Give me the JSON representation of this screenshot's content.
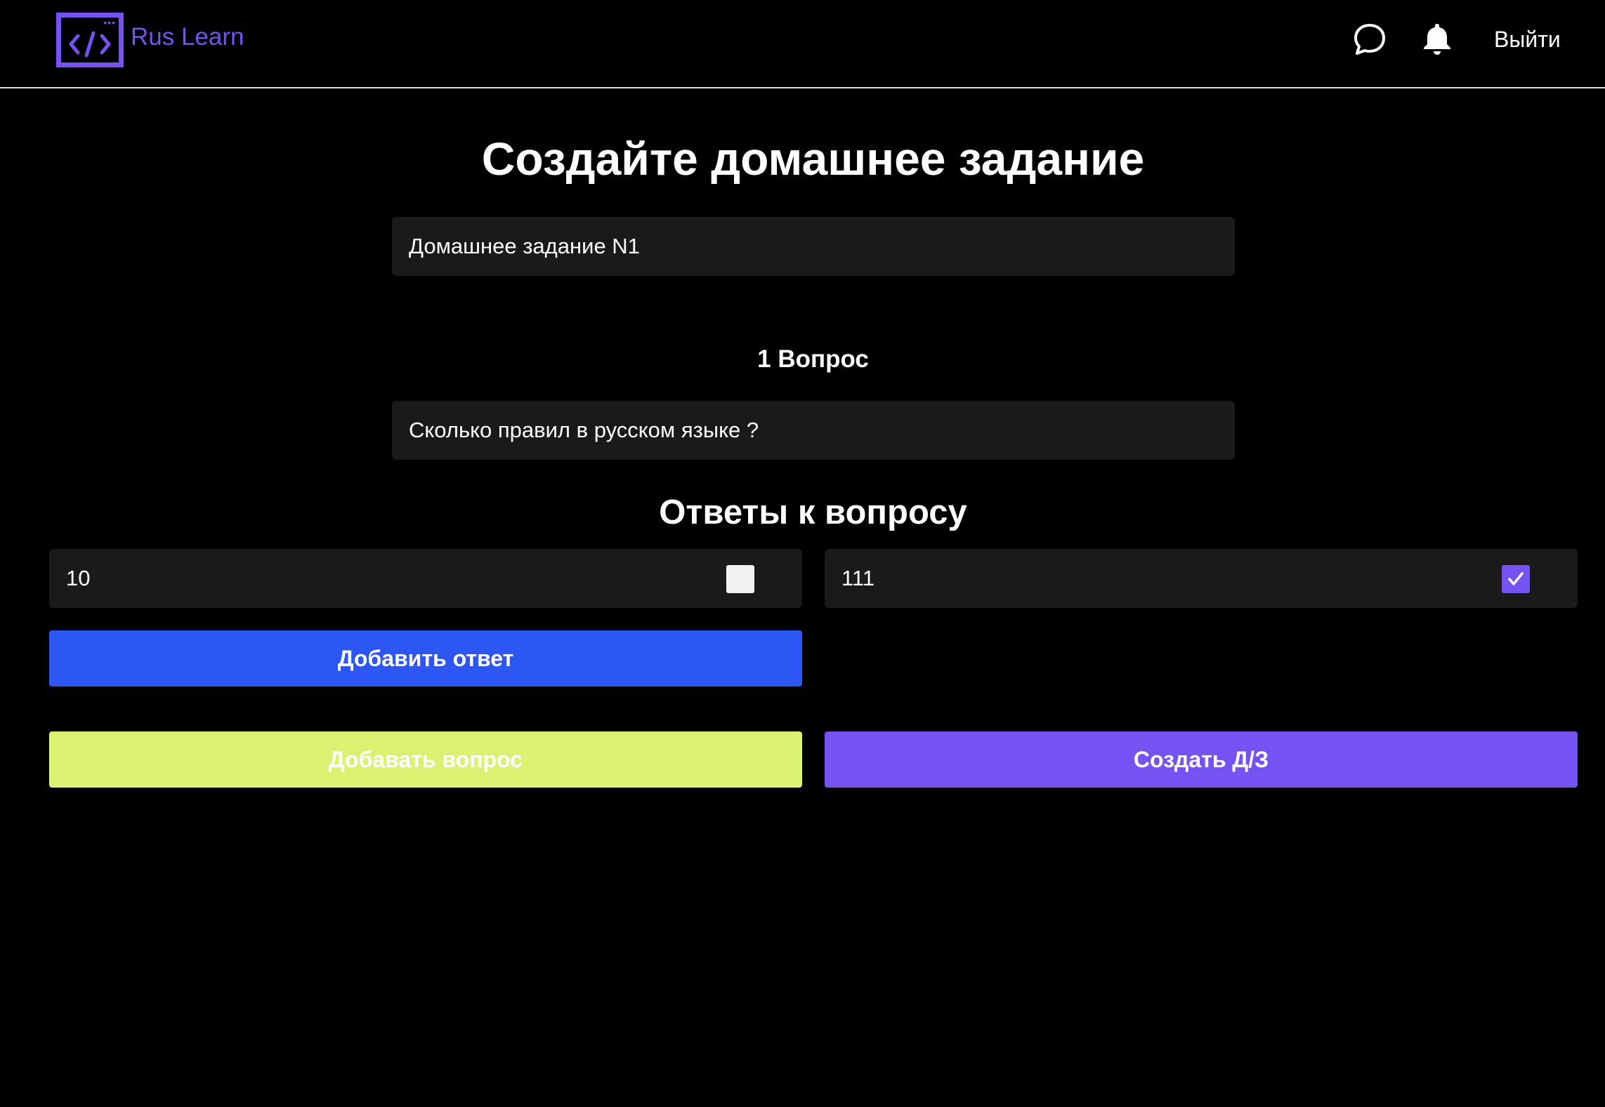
{
  "header": {
    "brand": "Rus Learn",
    "logout_label": "Выйти",
    "accent_color": "#7552f2",
    "icons": [
      "code-window-icon",
      "chat-icon",
      "bell-icon"
    ]
  },
  "main": {
    "title": "Создайте домашнее задание",
    "homework_name_value": "Домашнее задание N1",
    "question_label": "1 Вопрос",
    "question_value": "Сколько правил в русском языке ?",
    "answers_title": "Ответы к вопросу",
    "answers": [
      {
        "value": "10",
        "correct": false
      },
      {
        "value": "111",
        "correct": true
      }
    ],
    "add_answer_label": "Добавить ответ",
    "add_question_label": "Добавать вопрос",
    "create_label": "Создать Д/З"
  },
  "colors": {
    "add_answer": "#2c57f5",
    "add_question": "#d9f272",
    "create": "#7552f2",
    "input_bg": "#1a1a1a"
  }
}
